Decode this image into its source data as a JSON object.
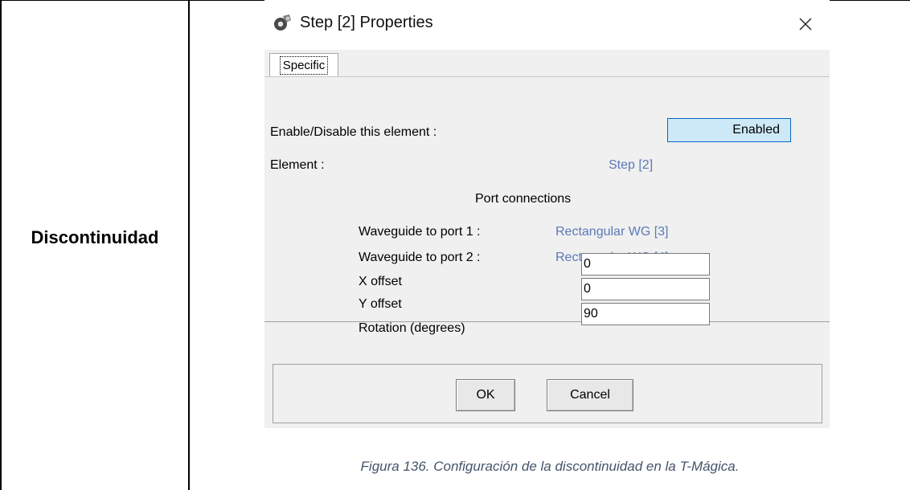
{
  "document": {
    "row_label": "Discontinuidad",
    "caption": "Figura 136. Configuración de la discontinuidad en la T-Mágica."
  },
  "dialog": {
    "title": "Step [2] Properties",
    "close_glyph": "×",
    "tab_label": "Specific",
    "enable_label": "Enable/Disable this element :",
    "enable_value": "Enabled",
    "element_label": "Element :",
    "element_value": "Step [2]",
    "port_heading": "Port connections",
    "port1_label": "Waveguide to port 1 :",
    "port1_value": "Rectangular WG [3]",
    "port2_label": "Waveguide to port 2 :",
    "port2_value": "Rectangular WG [4]",
    "x_offset_label": "X offset",
    "x_offset_value": "0",
    "y_offset_label": "Y offset",
    "y_offset_value": "0",
    "rotation_label": "Rotation (degrees)",
    "rotation_value": "90",
    "ok_label": "OK",
    "cancel_label": "Cancel"
  },
  "icons": {
    "app_icon": "gear-globe-icon",
    "close_icon": "close-icon"
  }
}
